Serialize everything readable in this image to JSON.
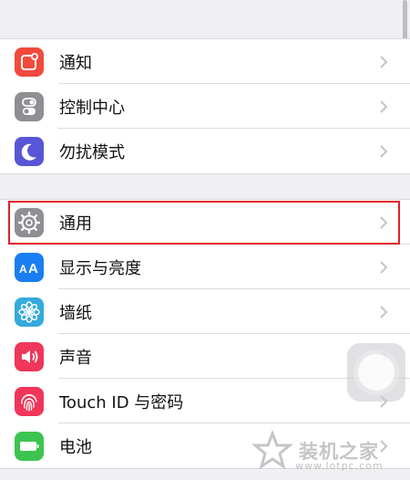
{
  "groups": [
    {
      "items": [
        {
          "label": "通知",
          "icon": "notifications-icon",
          "color": "#f24a3d"
        },
        {
          "label": "控制中心",
          "icon": "control-center-icon",
          "color": "#8e8e93"
        },
        {
          "label": "勿扰模式",
          "icon": "do-not-disturb-moon-icon",
          "color": "#5856d6"
        }
      ]
    },
    {
      "items": [
        {
          "label": "通用",
          "icon": "gear-icon",
          "color": "#8e8e93"
        },
        {
          "label": "显示与亮度",
          "icon": "display-brightness-icon",
          "color": "#1a7ef2"
        },
        {
          "label": "墙纸",
          "icon": "wallpaper-flower-icon",
          "color": "#35aadc"
        },
        {
          "label": "声音",
          "icon": "sound-speaker-icon",
          "color": "#f0365a"
        },
        {
          "label": "Touch ID 与密码",
          "icon": "fingerprint-icon",
          "color": "#f0365a"
        },
        {
          "label": "电池",
          "icon": "battery-icon",
          "color": "#3cc450"
        }
      ]
    }
  ],
  "watermark": {
    "text": "装机之家",
    "url": "www.lotpc.com"
  },
  "highlight_color": "#e0202a"
}
